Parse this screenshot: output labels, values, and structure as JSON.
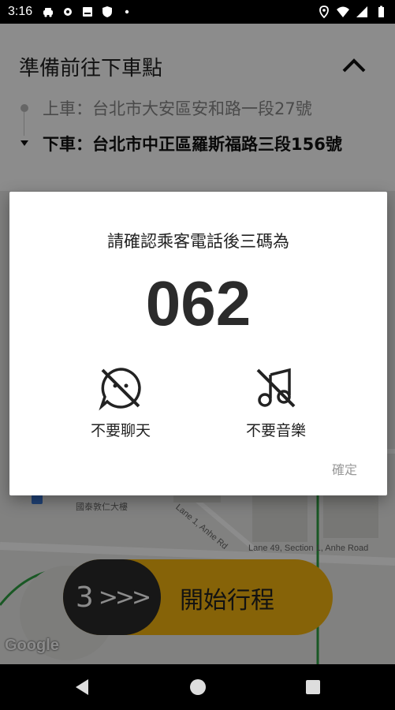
{
  "status_bar": {
    "time": "3:16",
    "left_icons": [
      "car-icon",
      "gear-icon",
      "id-card-icon",
      "shield-icon",
      "dot-icon"
    ],
    "right_icons": [
      "location-icon",
      "wifi-icon",
      "signal-icon",
      "battery-icon"
    ]
  },
  "trip_panel": {
    "title": "準備前往下車點",
    "pickup": "上車：台北市大安區安和路一段27號",
    "dropoff": "下車：台北市中正區羅斯福路三段156號"
  },
  "map": {
    "labels": [
      "國泰敦仁大樓",
      "Lane 49, Section 1, Anhe Road",
      "Lane 1, Anhe Rd"
    ],
    "attribution": "Google"
  },
  "dialog": {
    "title": "請確認乘客電話後三碼為",
    "code": "062",
    "prefs": [
      {
        "icon": "no-chat-icon",
        "label": "不要聊天"
      },
      {
        "icon": "no-music-icon",
        "label": "不要音樂"
      }
    ],
    "confirm_label": "確定"
  },
  "start_slider": {
    "countdown": "3",
    "arrows": ">>>",
    "label": "開始行程"
  },
  "colors": {
    "accent": "#f5b50f",
    "knob": "#2a2a2a",
    "route": "#2ea043"
  }
}
